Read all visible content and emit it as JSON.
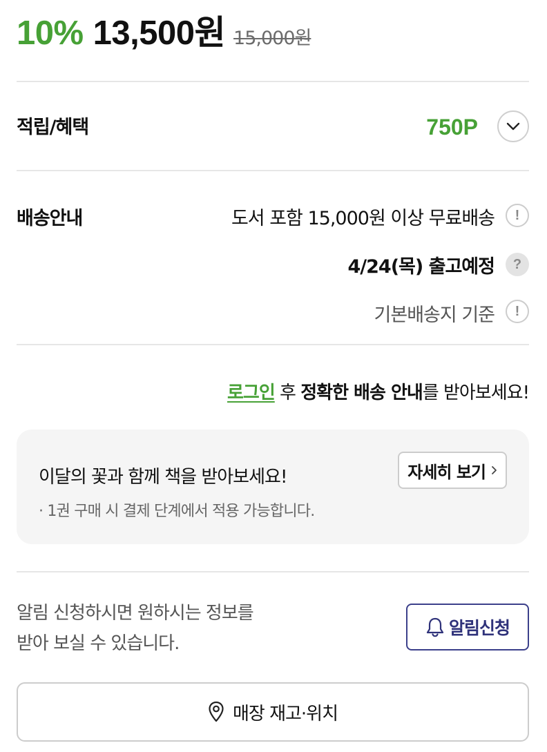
{
  "price": {
    "discount_rate": "10%",
    "sale_price": "13,500원",
    "original_price": "15,000원"
  },
  "benefit": {
    "label": "적립/혜택",
    "points": "750P",
    "expand_icon": "chevron-down-icon"
  },
  "shipping": {
    "label": "배송안내",
    "line1": "도서 포함 15,000원 이상 무료배송",
    "line2": "4/24(목) 출고예정",
    "line3": "기본배송지 기준",
    "icons": [
      "exclamation-circle-icon",
      "question-circle-icon",
      "exclamation-circle-icon"
    ],
    "icon_glyphs": [
      "!",
      "?",
      "!"
    ]
  },
  "login_notice": {
    "link": "로그인",
    "part1": " 후 ",
    "bold": "정확한 배송 안내",
    "part2": "를 받아보세요!"
  },
  "promo": {
    "title": "이달의 꽃과 함께 책을 받아보세요!",
    "detail_button": "자세히 보기",
    "note": "· 1권 구매 시 결제 단계에서 적용 가능합니다."
  },
  "alert": {
    "line1": "알림 신청하시면 원하시는 정보를",
    "line2": "받아 보실 수 있습니다.",
    "button": "알림신청"
  },
  "store": {
    "button": "매장 재고·위치"
  },
  "colors": {
    "accent_green": "#47a136",
    "alert_navy": "#2f327a",
    "divider": "#e6e6e6",
    "promo_bg": "#f5f5f5"
  }
}
